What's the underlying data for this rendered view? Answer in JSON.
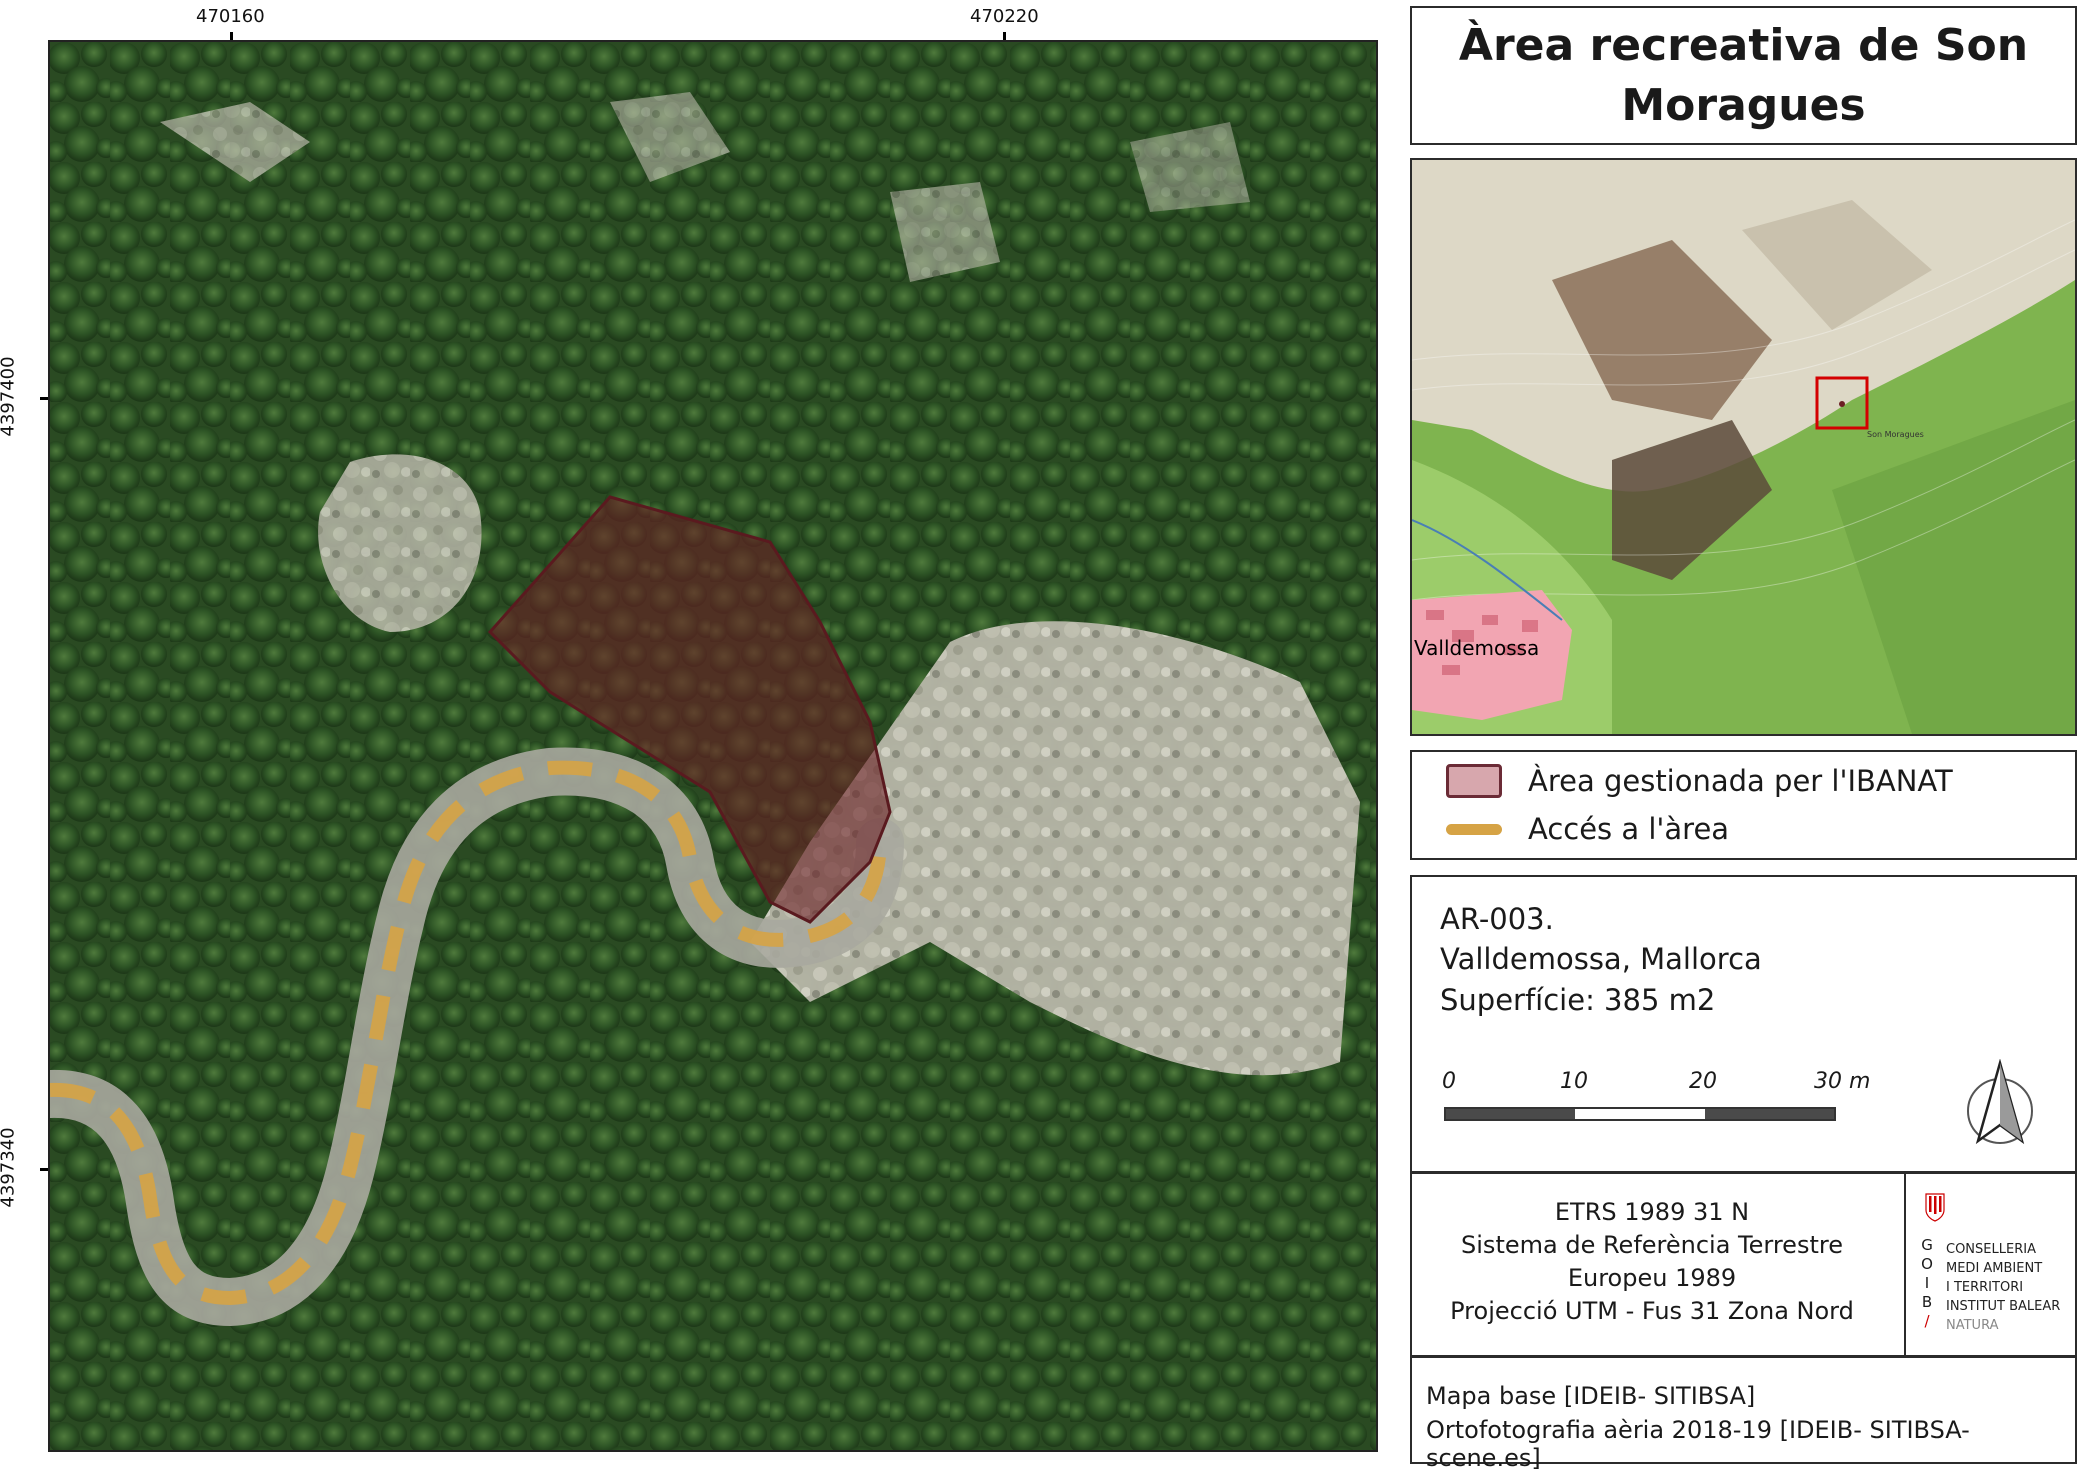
{
  "title": "Àrea recreativa de Son Moragues",
  "coordinates": {
    "x_ticks": [
      "470160",
      "470220"
    ],
    "y_ticks": [
      "4397400",
      "4397340"
    ]
  },
  "inset": {
    "place_label": "Valldemossa",
    "small_label": "Son Moragues"
  },
  "legend": {
    "items": [
      {
        "label": "Àrea gestionada per l'IBANAT",
        "swatch": "#d7a7ad",
        "border": "#6b2b36"
      },
      {
        "label": "Accés a l'àrea",
        "swatch": "#d6a345"
      }
    ]
  },
  "info": {
    "code": "AR-003.",
    "location": "Valldemossa, Mallorca",
    "area": "Superfície: 385 m2"
  },
  "scale": {
    "labels": [
      "0",
      "10",
      "20",
      "30 m"
    ]
  },
  "reference": {
    "lines": [
      "ETRS 1989 31 N",
      "Sistema de Referència Terrestre",
      "Europeu 1989",
      "Projecció UTM - Fus 31 Zona Nord"
    ]
  },
  "logo": {
    "letters": [
      "G",
      "O",
      "I",
      "B"
    ],
    "lines": [
      "CONSELLERIA",
      "MEDI AMBIENT",
      "I TERRITORI",
      "INSTITUT BALEAR",
      "NATURA"
    ]
  },
  "source": {
    "lines": [
      "Mapa base [IDEIB- SITIBSA]",
      "Ortofotografia aèria 2018-19 [IDEIB- SITIBSA-scene.es]"
    ]
  },
  "colors": {
    "managed_area": "#6b1f24",
    "access_path": "#d6a345",
    "inset_frame": "#d40000"
  }
}
